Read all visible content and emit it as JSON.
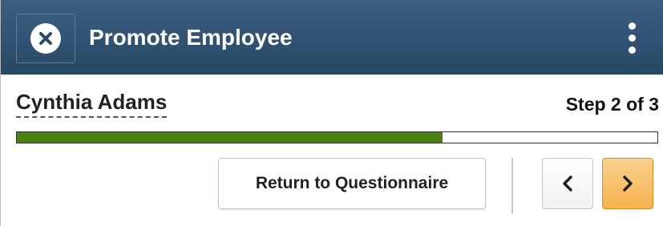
{
  "header": {
    "title": "Promote Employee",
    "close_icon": "close-icon",
    "menu_icon": "more-vertical-icon",
    "background": "#2f5173"
  },
  "employee": {
    "name": "Cynthia Adams"
  },
  "progress": {
    "step_text": "Step 2 of 3",
    "fraction": 0.665,
    "fill_color": "#4a820f"
  },
  "actions": {
    "return_label": "Return to Questionnaire",
    "prev_icon": "chevron-left-icon",
    "next_icon": "chevron-right-icon",
    "next_color": "#f6b24f"
  }
}
